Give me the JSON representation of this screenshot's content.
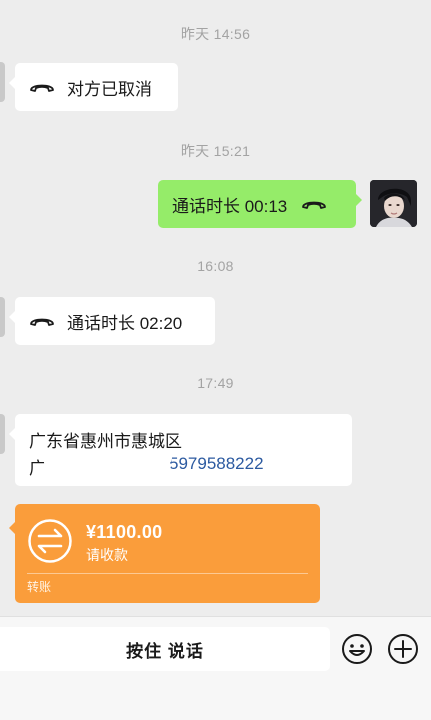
{
  "messages": {
    "ts1": "昨天 14:56",
    "call1": "对方已取消",
    "ts2": "昨天 15:21",
    "call2": "通话时长 00:13",
    "ts3": "16:08",
    "call3": "通话时长 02:20",
    "ts4": "17:49",
    "address": {
      "line1": "广东省惠州市惠城区",
      "line2_start": "广",
      "line2_phone": "5979588222"
    }
  },
  "transfer": {
    "amount": "¥1100.00",
    "status": "请收款",
    "footer": "转账"
  },
  "input_bar": {
    "hold_to_talk": "按住 说话"
  },
  "icons": {
    "call": "phone-hangup-icon",
    "transfer": "transfer-arrows-icon",
    "emoji": "emoji-icon",
    "add": "plus-circle-icon"
  },
  "colors": {
    "background": "#ededed",
    "self_bubble": "#95ec69",
    "other_bubble": "#ffffff",
    "transfer_card": "#fa9d3b",
    "timestamp_text": "#a3a3a3"
  }
}
